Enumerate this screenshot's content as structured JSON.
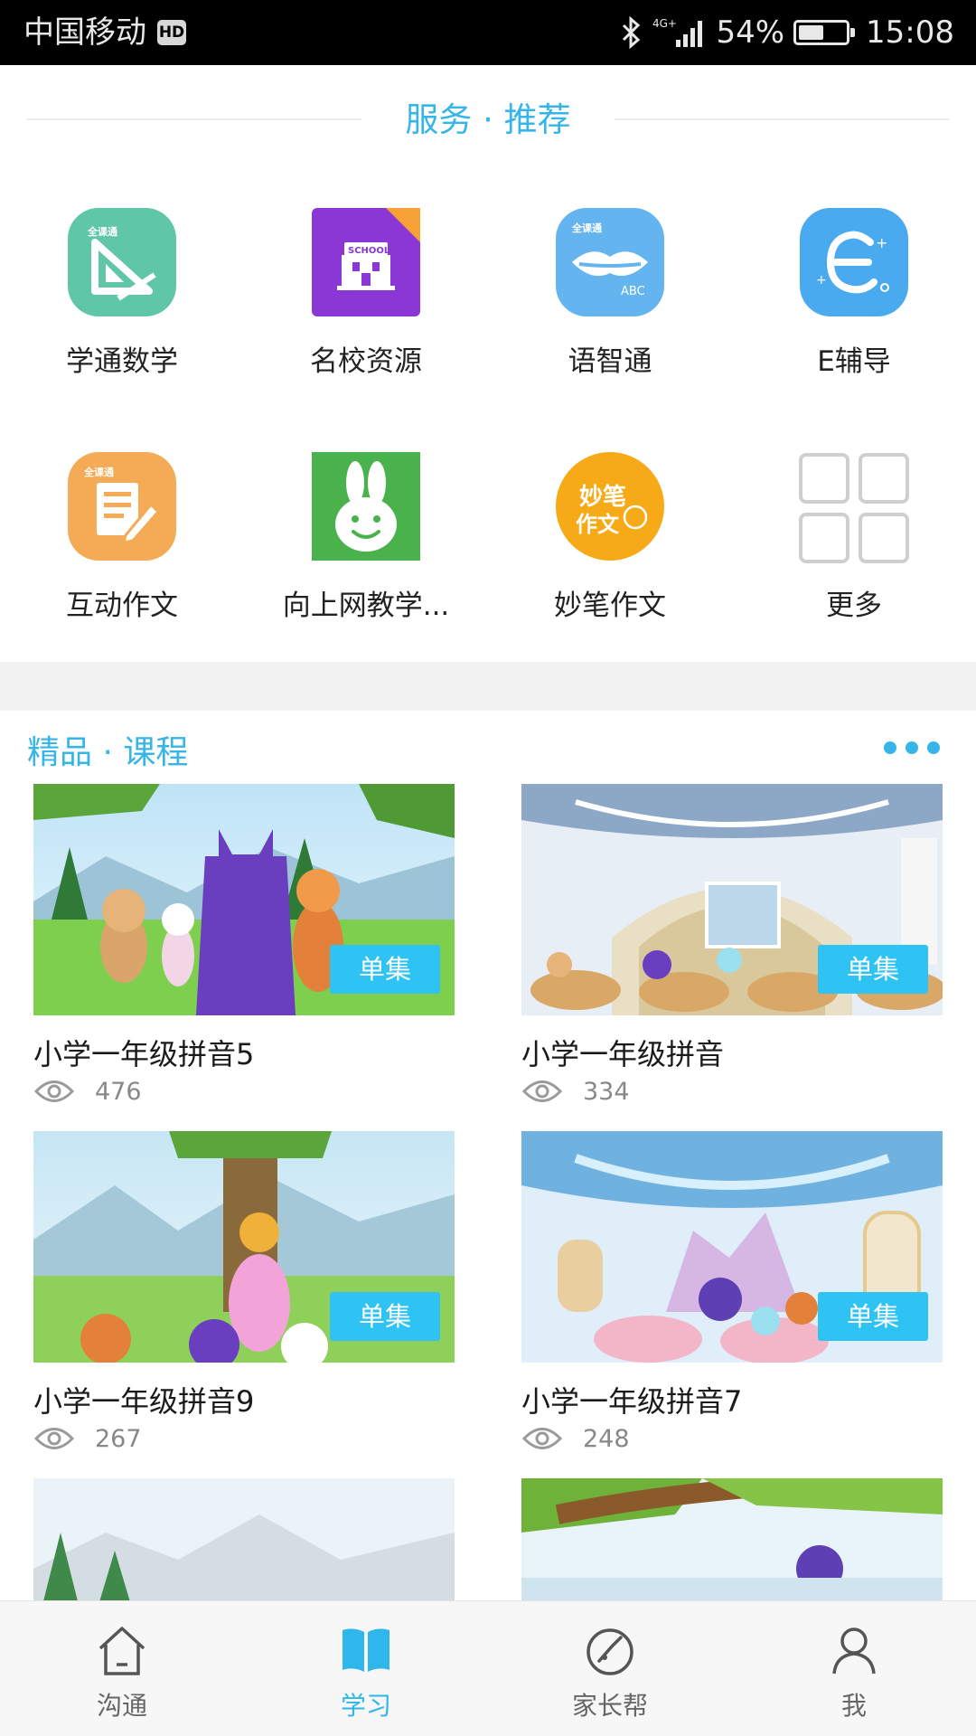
{
  "status_bar": {
    "carrier": "中国移动",
    "hd_badge": "HD",
    "network": "4G+",
    "battery_percent": "54%",
    "battery_level": 0.54,
    "time": "15:08"
  },
  "services": {
    "title": "服务 · 推荐",
    "items": [
      {
        "label": "学通数学",
        "icon": "ruler-triangle-icon",
        "color": "#5fc7a8"
      },
      {
        "label": "名校资源",
        "icon": "school-icon",
        "color": "#8a37d6"
      },
      {
        "label": "语智通",
        "icon": "lips-abc-icon",
        "color": "#64b4f0"
      },
      {
        "label": "E辅导",
        "icon": "letter-e-icon",
        "color": "#4aaaf0"
      },
      {
        "label": "互动作文",
        "icon": "writing-pad-icon",
        "color": "#f5ab55"
      },
      {
        "label": "向上网教学...",
        "icon": "rabbit-icon",
        "color": "#49b24d"
      },
      {
        "label": "妙笔作文",
        "icon": "miaobi-icon",
        "color": "#f6aa18",
        "icon_text": "妙笔作文"
      },
      {
        "label": "更多",
        "icon": "more-grid-icon",
        "color": "#cccccc"
      }
    ]
  },
  "courses": {
    "title": "精品 · 课程",
    "more_icon": "ellipsis-icon",
    "items": [
      {
        "title": "小学一年级拼音5",
        "views": "476",
        "tag": "单集"
      },
      {
        "title": "小学一年级拼音",
        "views": "334",
        "tag": "单集"
      },
      {
        "title": "小学一年级拼音9",
        "views": "267",
        "tag": "单集"
      },
      {
        "title": "小学一年级拼音7",
        "views": "248",
        "tag": "单集"
      },
      {
        "title": "",
        "views": "",
        "tag": ""
      },
      {
        "title": "",
        "views": "",
        "tag": ""
      }
    ]
  },
  "bottom_nav": {
    "items": [
      {
        "label": "沟通",
        "icon": "house-icon",
        "active": false
      },
      {
        "label": "学习",
        "icon": "book-icon",
        "active": true
      },
      {
        "label": "家长帮",
        "icon": "compass-icon",
        "active": false
      },
      {
        "label": "我",
        "icon": "person-icon",
        "active": false
      }
    ],
    "active_color": "#2fb6ea"
  }
}
